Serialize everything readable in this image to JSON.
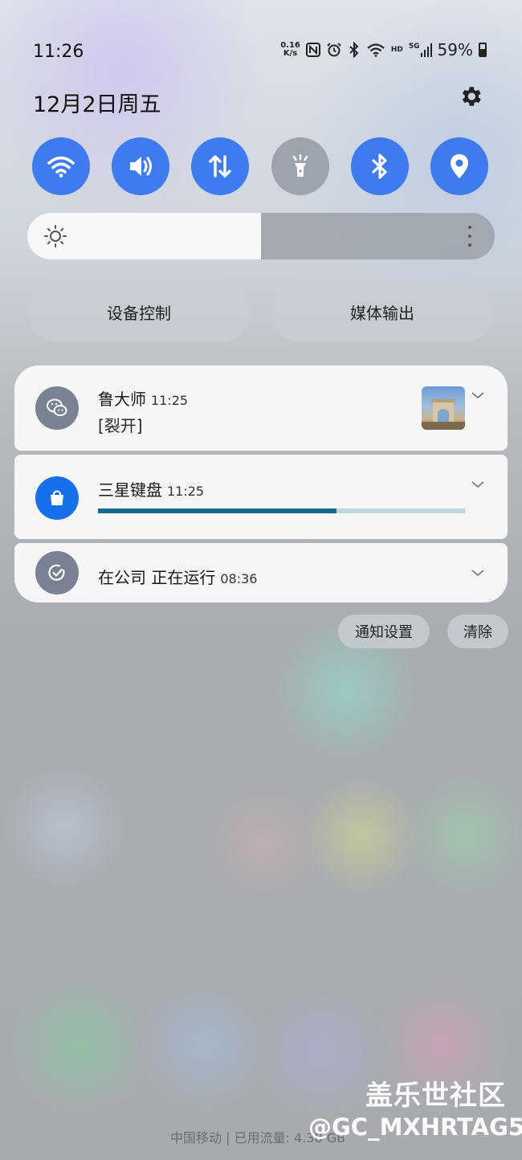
{
  "status_bar": {
    "time": "11:26",
    "net_speed_value": "0.16",
    "net_speed_unit": "K/s",
    "icons": [
      "nfc-icon",
      "alarm-icon",
      "bluetooth-icon",
      "wifi-icon",
      "hd-icon",
      "signal-5g-icon",
      "battery-icon"
    ],
    "hd_label": "HD",
    "network_label": "5G",
    "battery": "59%",
    "battery_level": 0.59
  },
  "header": {
    "date": "12月2日周五"
  },
  "quick_toggles": [
    {
      "name": "wifi",
      "icon": "wifi-icon",
      "on": true
    },
    {
      "name": "sound",
      "icon": "volume-icon",
      "on": true
    },
    {
      "name": "mobile-data",
      "icon": "data-arrows-icon",
      "on": true
    },
    {
      "name": "flashlight",
      "icon": "flashlight-icon",
      "on": false
    },
    {
      "name": "bluetooth",
      "icon": "bluetooth-icon",
      "on": true
    },
    {
      "name": "location",
      "icon": "location-icon",
      "on": true
    }
  ],
  "colors": {
    "toggle_on": "#3e7bf0",
    "toggle_off": "#9ea4ad",
    "progress": "#126a90",
    "progress_track": "#bfd6dc"
  },
  "brightness": {
    "level": 0.5
  },
  "panel_buttons": {
    "device_control": "设备控制",
    "media_output": "媒体输出"
  },
  "notifications": [
    {
      "title": "鲁大师",
      "time": "11:25",
      "text": "[裂开]",
      "icon": "wechat-icon"
    },
    {
      "title": "三星键盘",
      "time": "11:25",
      "progress": 0.65,
      "icon": "shopping-bag-icon"
    },
    {
      "title": "在公司 正在运行",
      "time": "08:36",
      "icon": "check-circle-icon"
    }
  ],
  "actions": {
    "notification_settings": "通知设置",
    "clear": "清除"
  },
  "footer": {
    "carrier": "中国移动 | 已用流量: 4.38 GB"
  },
  "watermark": {
    "site": "盖乐世社区",
    "user": "@GC_MXHRTAG5"
  }
}
